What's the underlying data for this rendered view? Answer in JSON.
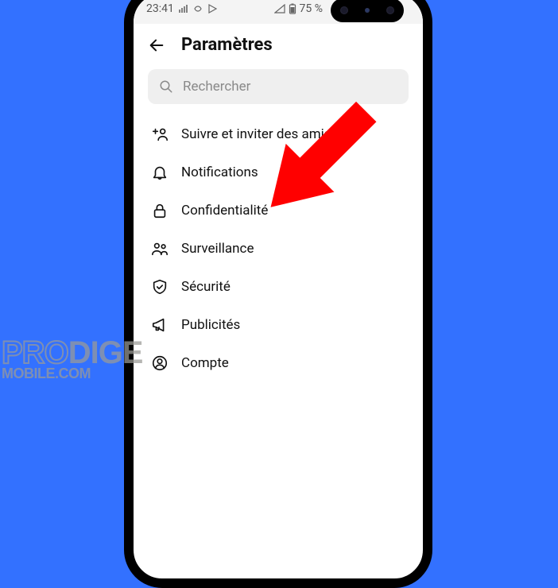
{
  "statusbar": {
    "time": "23:41",
    "battery": "75 %"
  },
  "header": {
    "title": "Paramètres"
  },
  "search": {
    "placeholder": "Rechercher"
  },
  "menu": {
    "items": [
      {
        "label": "Suivre et inviter des amis"
      },
      {
        "label": "Notifications"
      },
      {
        "label": "Confidentialité"
      },
      {
        "label": "Surveillance"
      },
      {
        "label": "Sécurité"
      },
      {
        "label": "Publicités"
      },
      {
        "label": "Compte"
      }
    ]
  },
  "watermark": {
    "line1a": "PRO",
    "line1b": "DIGE",
    "line2": "MOBILE.COM"
  }
}
